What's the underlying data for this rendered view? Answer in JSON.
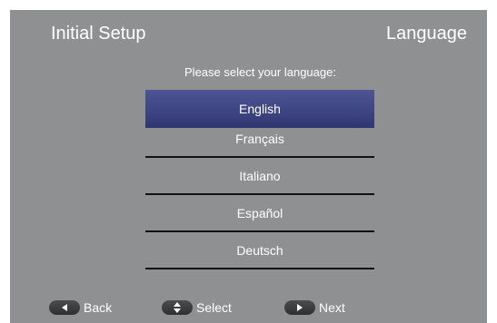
{
  "header": {
    "title": "Initial Setup",
    "section": "Language"
  },
  "prompt": "Please select your language:",
  "languages": [
    {
      "label": "English",
      "selected": true
    },
    {
      "label": "Français",
      "selected": false
    },
    {
      "label": "Italiano",
      "selected": false
    },
    {
      "label": "Español",
      "selected": false
    },
    {
      "label": "Deutsch",
      "selected": false
    }
  ],
  "footer": {
    "back_label": "Back",
    "select_label": "Select",
    "next_label": "Next",
    "back_icon": "triangle-left-icon",
    "select_icon": "up-down-arrows-icon",
    "next_icon": "triangle-right-icon"
  },
  "colors": {
    "background": "#8e9092",
    "highlight": "#3e4583",
    "text": "#ffffff",
    "button": "#3a3c3f"
  }
}
